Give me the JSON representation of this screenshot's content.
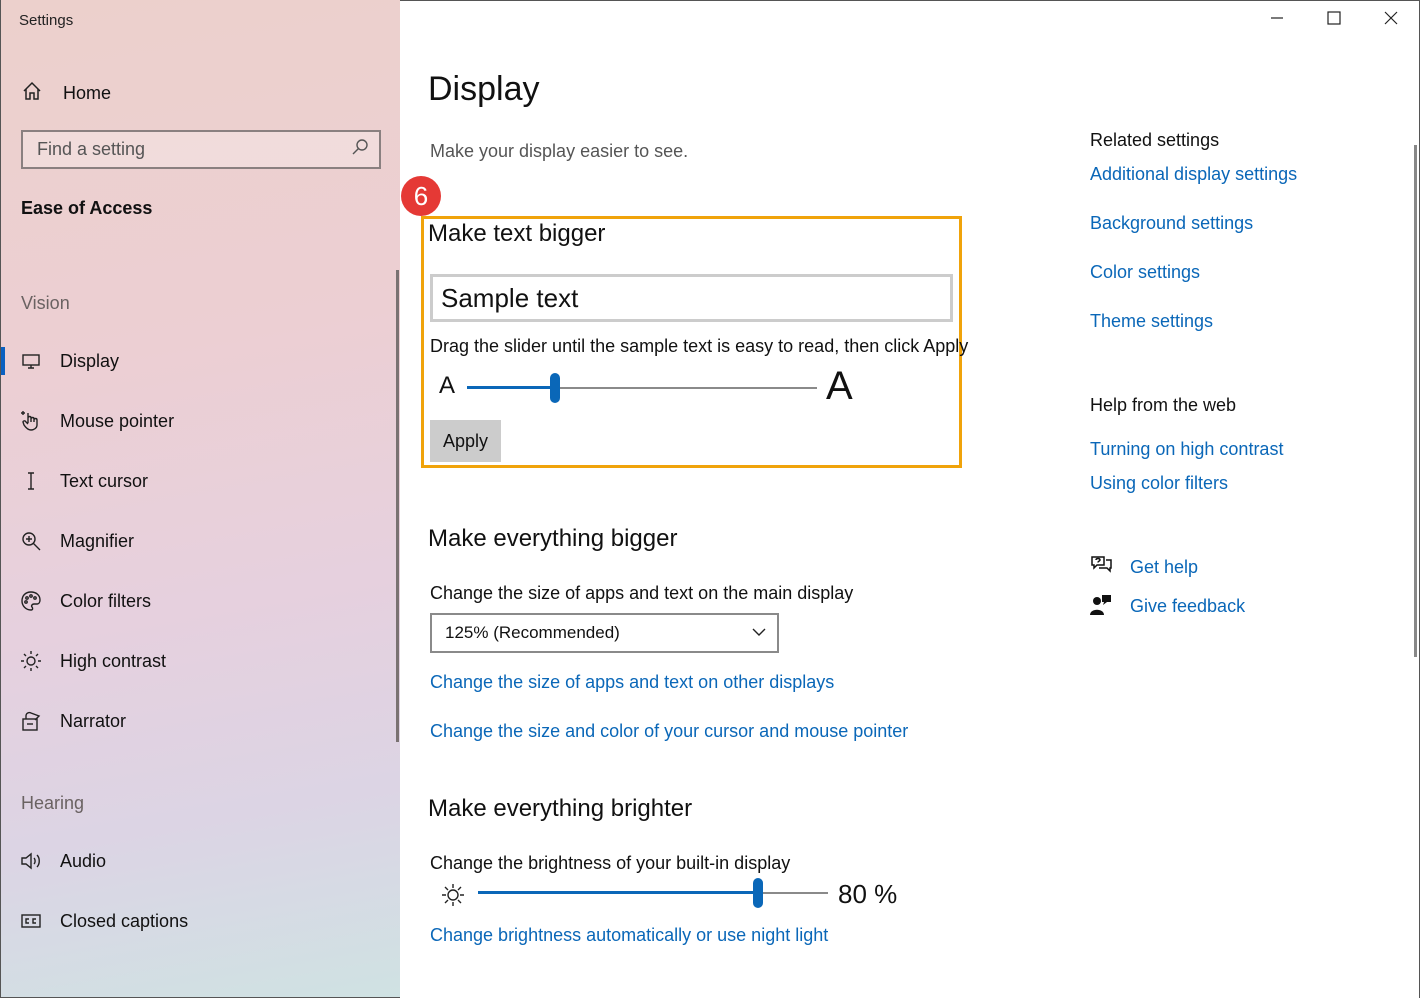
{
  "window": {
    "title": "Settings",
    "minimize_icon": "minimize-icon",
    "maximize_icon": "maximize-icon",
    "close_icon": "close-icon"
  },
  "sidebar": {
    "home_label": "Home",
    "search_placeholder": "Find a setting",
    "section_title": "Ease of Access",
    "groups": [
      {
        "label": "Vision",
        "items": [
          {
            "label": "Display",
            "icon": "display-icon",
            "active": true
          },
          {
            "label": "Mouse pointer",
            "icon": "mouse-pointer-icon"
          },
          {
            "label": "Text cursor",
            "icon": "text-cursor-icon"
          },
          {
            "label": "Magnifier",
            "icon": "magnifier-icon"
          },
          {
            "label": "Color filters",
            "icon": "color-filters-icon"
          },
          {
            "label": "High contrast",
            "icon": "high-contrast-icon"
          },
          {
            "label": "Narrator",
            "icon": "narrator-icon"
          }
        ]
      },
      {
        "label": "Hearing",
        "items": [
          {
            "label": "Audio",
            "icon": "audio-icon"
          },
          {
            "label": "Closed captions",
            "icon": "closed-captions-icon"
          }
        ]
      }
    ]
  },
  "main": {
    "title": "Display",
    "subtitle": "Make your display easier to see.",
    "badge": "6",
    "text_bigger": {
      "heading": "Make text bigger",
      "sample_text": "Sample text",
      "instruction": "Drag the slider until the sample text is easy to read, then click Apply",
      "small_a": "A",
      "large_a": "A",
      "slider_value_fraction": 0.25,
      "apply_label": "Apply"
    },
    "everything_bigger": {
      "heading": "Make everything bigger",
      "description": "Change the size of apps and text on the main display",
      "selected_option": "125% (Recommended)",
      "link_other_displays": "Change the size of apps and text on other displays",
      "link_cursor": "Change the size and color of your cursor and mouse pointer"
    },
    "everything_brighter": {
      "heading": "Make everything brighter",
      "description": "Change the brightness of your built-in display",
      "brightness_value": "80 %",
      "brightness_fraction": 0.8,
      "link_night_light": "Change brightness automatically or use night light"
    }
  },
  "related": {
    "title": "Related settings",
    "links": [
      "Additional display settings",
      "Background settings",
      "Color settings",
      "Theme settings"
    ],
    "help_title": "Help from the web",
    "help_links": [
      "Turning on high contrast",
      "Using color filters"
    ],
    "get_help": "Get help",
    "give_feedback": "Give feedback"
  },
  "colors": {
    "accent": "#0a67b8",
    "highlight_border": "#f0a30a",
    "badge": "#e53935"
  }
}
